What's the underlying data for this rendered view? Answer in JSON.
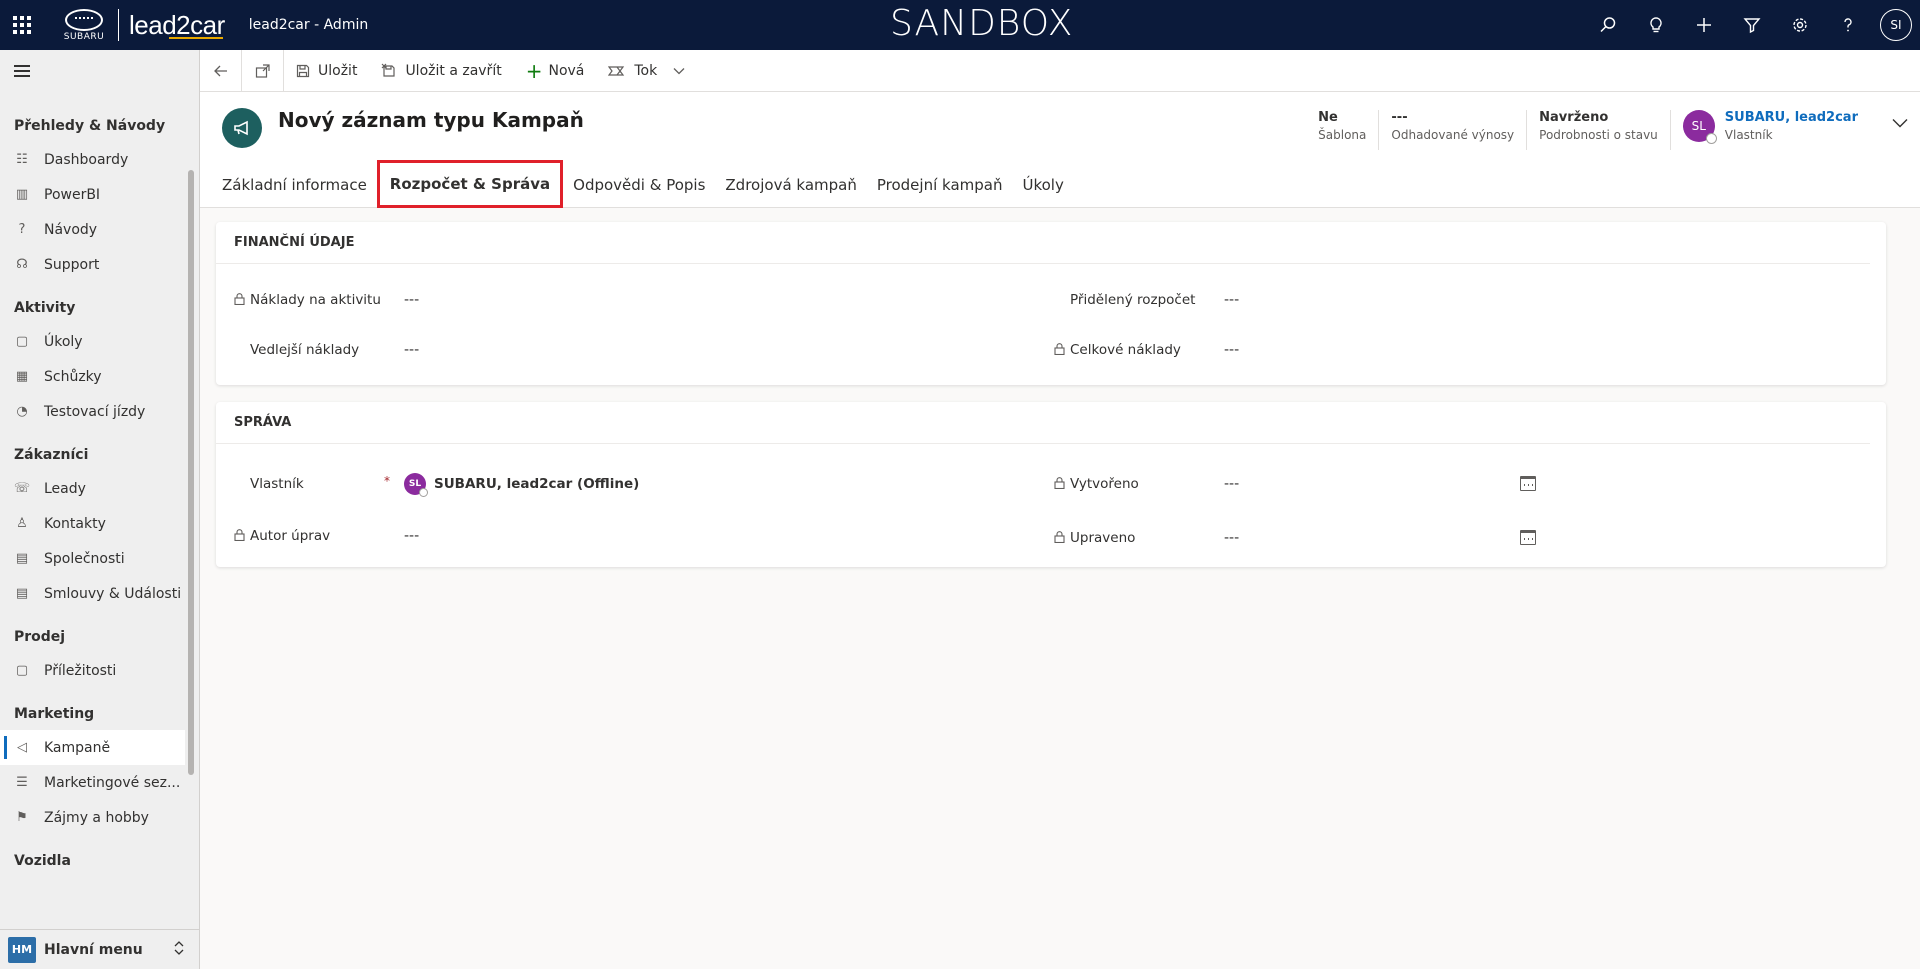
{
  "topbar": {
    "brand_small": "SUBARU",
    "brand_main": "lead2car",
    "app_name": "lead2car - Admin",
    "environment": "SANDBOX",
    "user_initials": "SI",
    "icons": [
      "search-icon",
      "lightbulb-icon",
      "plus-icon",
      "filter-icon",
      "gear-icon",
      "help-icon"
    ]
  },
  "sidebar": {
    "groups": [
      {
        "title": "Přehledy & Návody",
        "items": [
          {
            "label": "Dashboardy",
            "icon": "dashboard-icon"
          },
          {
            "label": "PowerBI",
            "icon": "chart-icon"
          },
          {
            "label": "Návody",
            "icon": "help-doc-icon"
          },
          {
            "label": "Support",
            "icon": "support-icon"
          }
        ]
      },
      {
        "title": "Aktivity",
        "items": [
          {
            "label": "Úkoly",
            "icon": "task-icon"
          },
          {
            "label": "Schůzky",
            "icon": "calendar-icon"
          },
          {
            "label": "Testovací jízdy",
            "icon": "gauge-icon"
          }
        ]
      },
      {
        "title": "Zákazníci",
        "items": [
          {
            "label": "Leady",
            "icon": "phone-person-icon"
          },
          {
            "label": "Kontakty",
            "icon": "person-icon"
          },
          {
            "label": "Společnosti",
            "icon": "building-icon"
          },
          {
            "label": "Smlouvy & Události",
            "icon": "contract-icon"
          }
        ]
      },
      {
        "title": "Prodej",
        "items": [
          {
            "label": "Příležitosti",
            "icon": "opportunity-icon"
          }
        ]
      },
      {
        "title": "Marketing",
        "items": [
          {
            "label": "Kampaně",
            "icon": "megaphone-icon",
            "active": true
          },
          {
            "label": "Marketingové sez...",
            "icon": "list-icon"
          },
          {
            "label": "Zájmy a hobby",
            "icon": "flag-icon"
          }
        ]
      },
      {
        "title": "Vozidla",
        "items": []
      }
    ],
    "bottom": {
      "badge": "HM",
      "label": "Hlavní menu"
    }
  },
  "commandbar": {
    "save": "Uložit",
    "save_close": "Uložit a zavřít",
    "new": "Nová",
    "flow": "Tok"
  },
  "header": {
    "title": "Nový záznam typu Kampaň",
    "fields": [
      {
        "value": "Ne",
        "label": "Šablona"
      },
      {
        "value": "---",
        "label": "Odhadované výnosy"
      },
      {
        "value": "Navrženo",
        "label": "Podrobnosti o stavu"
      }
    ],
    "owner": {
      "initials": "SL",
      "name": "SUBARU, lead2car",
      "label": "Vlastník"
    }
  },
  "tabs": [
    {
      "label": "Základní informace"
    },
    {
      "label": "Rozpočet & Správa",
      "active": true
    },
    {
      "label": "Odpovědi & Popis"
    },
    {
      "label": "Zdrojová kampaň"
    },
    {
      "label": "Prodejní kampaň"
    },
    {
      "label": "Úkoly"
    }
  ],
  "finance": {
    "title": "FINANČNÍ ÚDAJE",
    "activity_cost_label": "Náklady na aktivitu",
    "activity_cost_value": "---",
    "misc_cost_label": "Vedlejší náklady",
    "misc_cost_value": "---",
    "budget_label": "Přidělený rozpočet",
    "budget_value": "---",
    "total_cost_label": "Celkové náklady",
    "total_cost_value": "---"
  },
  "admin": {
    "title": "SPRÁVA",
    "owner_label": "Vlastník",
    "owner_required": "*",
    "owner_initials": "SL",
    "owner_value": "SUBARU, lead2car (Offline)",
    "modified_by_label": "Autor úprav",
    "modified_by_value": "---",
    "created_label": "Vytvořeno",
    "created_value": "---",
    "modified_label": "Upraveno",
    "modified_value": "---"
  }
}
